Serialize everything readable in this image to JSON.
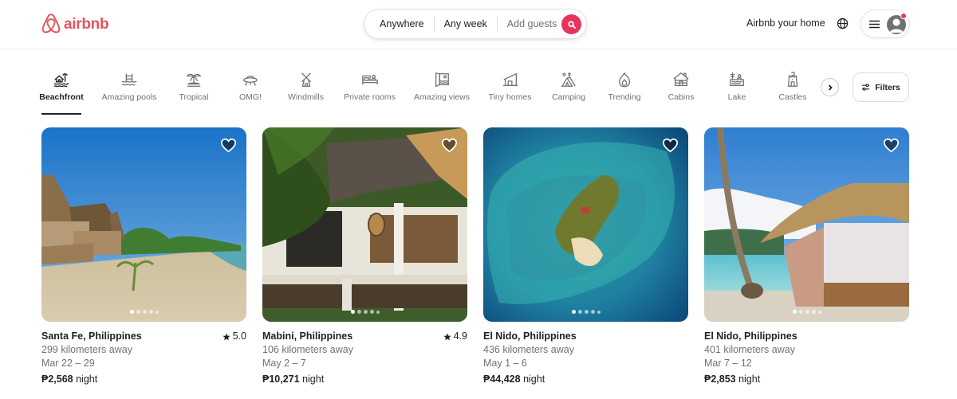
{
  "header": {
    "brand": "airbnb",
    "brand_color": "#e0565b",
    "search": {
      "where": "Anywhere",
      "when": "Any week",
      "who_placeholder": "Add guests",
      "button_color": "#e8335a"
    },
    "host_link": "Airbnb your home",
    "icons": {
      "language": "globe-icon",
      "menu": "hamburger-icon",
      "profile": "user-avatar-icon"
    }
  },
  "categories": [
    {
      "label": "Beachfront",
      "icon": "beachfront-icon",
      "active": true
    },
    {
      "label": "Amazing pools",
      "icon": "pool-icon",
      "active": false
    },
    {
      "label": "Tropical",
      "icon": "palm-tree-icon",
      "active": false
    },
    {
      "label": "OMG!",
      "icon": "ufo-icon",
      "active": false
    },
    {
      "label": "Windmills",
      "icon": "windmill-icon",
      "active": false
    },
    {
      "label": "Private rooms",
      "icon": "bed-icon",
      "active": false
    },
    {
      "label": "Amazing views",
      "icon": "view-icon",
      "active": false
    },
    {
      "label": "Tiny homes",
      "icon": "tiny-home-icon",
      "active": false
    },
    {
      "label": "Camping",
      "icon": "tent-icon",
      "active": false
    },
    {
      "label": "Trending",
      "icon": "flame-icon",
      "active": false
    },
    {
      "label": "Cabins",
      "icon": "cabin-icon",
      "active": false
    },
    {
      "label": "Lake",
      "icon": "lake-icon",
      "active": false
    },
    {
      "label": "Castles",
      "icon": "castle-icon",
      "active": false
    }
  ],
  "filters_label": "Filters",
  "listings": [
    {
      "location": "Santa Fe, Philippines",
      "rating": "5.0",
      "distance": "299 kilometers away",
      "dates": "Mar 22 – 29",
      "price": "₱2,568",
      "price_unit": "night",
      "photo": "beach with thatched huts",
      "photo_index": 1,
      "photo_count": 5
    },
    {
      "location": "Mabini, Philippines",
      "rating": "4.9",
      "distance": "106 kilometers away",
      "dates": "May 2 – 7",
      "price": "₱10,271",
      "price_unit": "night",
      "photo": "thatched-roof villa with veranda",
      "photo_index": 1,
      "photo_count": 5
    },
    {
      "location": "El Nido, Philippines",
      "rating": null,
      "distance": "436 kilometers away",
      "dates": "May 1 – 6",
      "price": "₱44,428",
      "price_unit": "night",
      "photo": "aerial view of island and reef",
      "photo_index": 1,
      "photo_count": 5
    },
    {
      "location": "El Nido, Philippines",
      "rating": null,
      "distance": "401 kilometers away",
      "dates": "Mar 7 – 12",
      "price": "₱2,853",
      "price_unit": "night",
      "photo": "beach hut with palm tree",
      "photo_index": 1,
      "photo_count": 5
    }
  ]
}
